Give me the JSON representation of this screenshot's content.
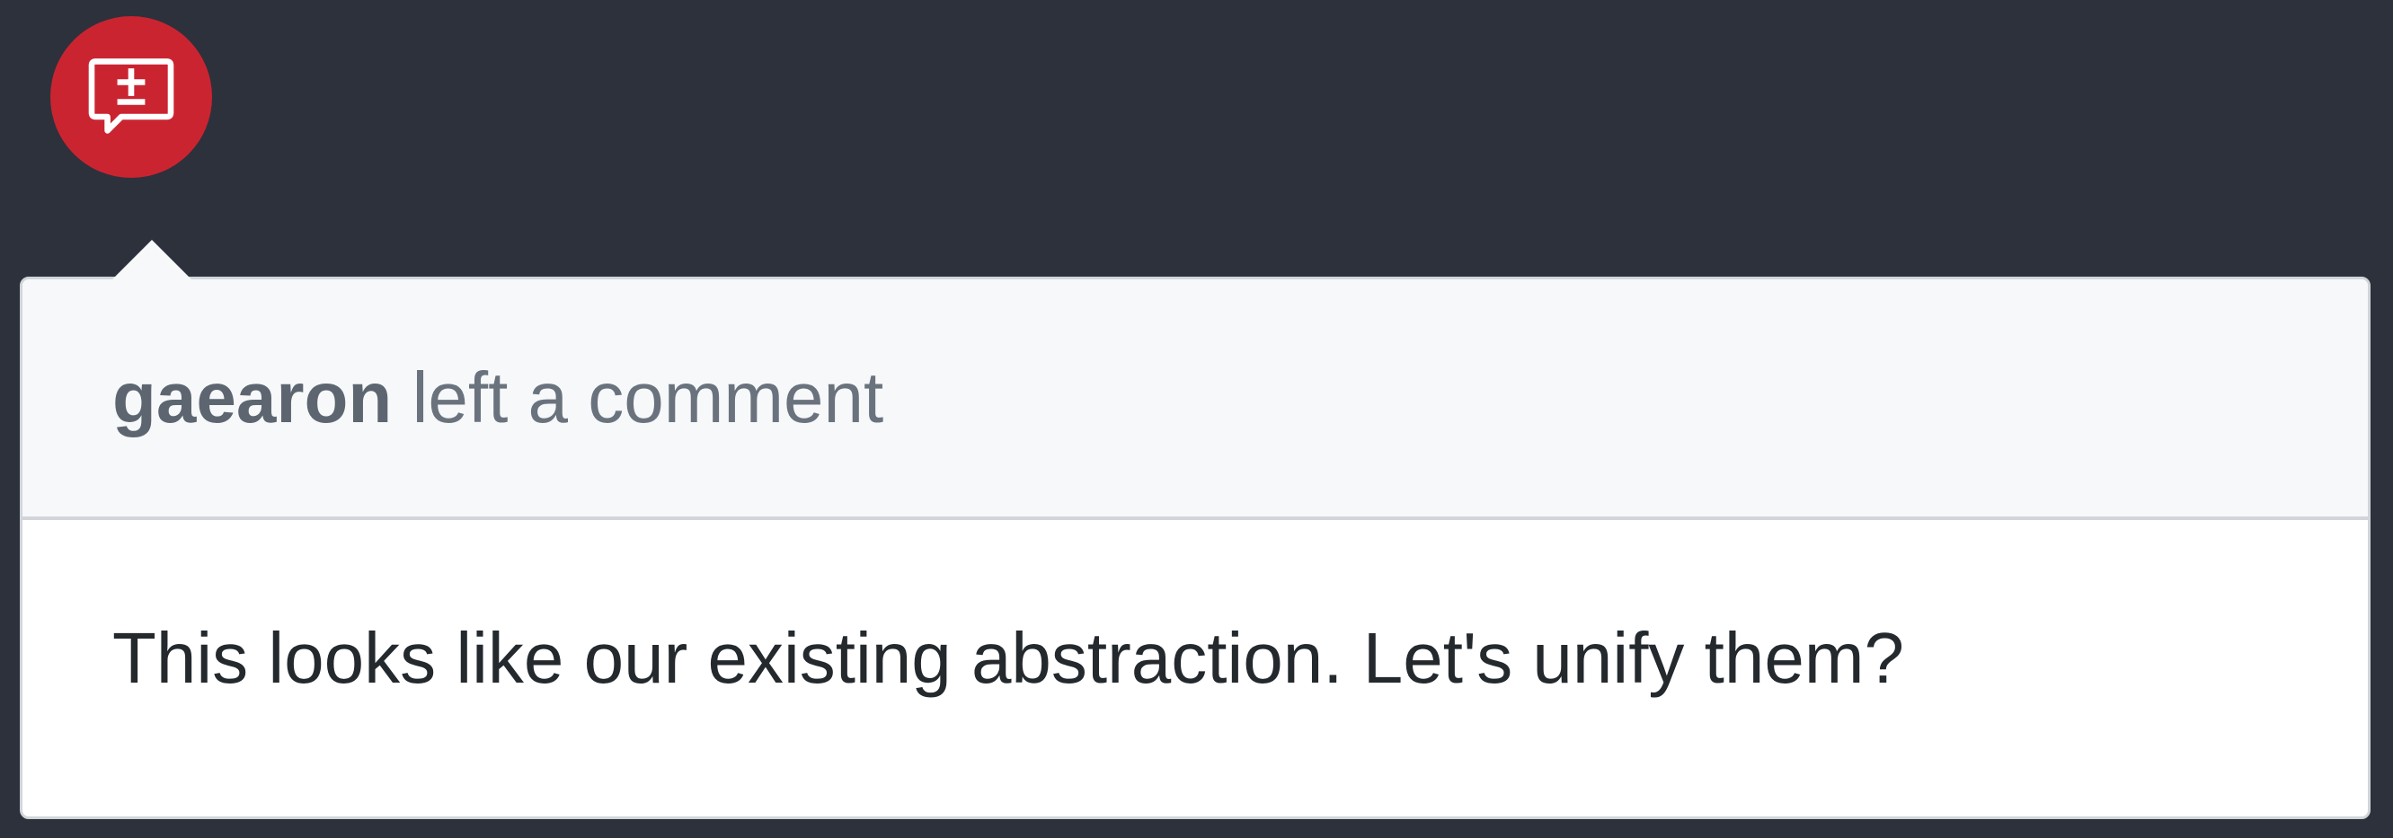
{
  "review": {
    "icon": "diff-comment-icon",
    "badge_color": "#cb2431"
  },
  "comment": {
    "author": "gaearon",
    "action": "left a comment",
    "body": "This looks like our existing abstraction. Let's unify them?"
  },
  "colors": {
    "background": "#2d313b",
    "header_bg": "#f6f8fa",
    "body_text": "#24292e",
    "muted_text": "#6a737d"
  }
}
